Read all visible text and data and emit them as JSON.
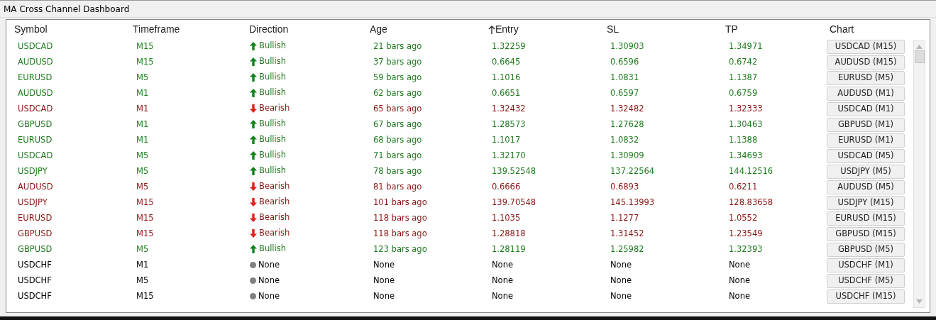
{
  "window": {
    "title": "MA Cross Channel Dashboard"
  },
  "table": {
    "columns": [
      {
        "label": "Symbol",
        "sorted": false
      },
      {
        "label": "Timeframe",
        "sorted": false
      },
      {
        "label": "Direction",
        "sorted": false
      },
      {
        "label": "Age",
        "sorted": false
      },
      {
        "label": "Entry",
        "sorted": true
      },
      {
        "label": "SL",
        "sorted": false
      },
      {
        "label": "TP",
        "sorted": false
      },
      {
        "label": "Chart",
        "sorted": false
      }
    ],
    "rows": [
      {
        "symbol": "USDCAD",
        "timeframe": "M15",
        "direction": "Bullish",
        "kind": "bullish",
        "age": "21 bars ago",
        "entry": "1.32259",
        "sl": "1.30903",
        "tp": "1.34971",
        "chart": "USDCAD (M15)"
      },
      {
        "symbol": "AUDUSD",
        "timeframe": "M15",
        "direction": "Bullish",
        "kind": "bullish",
        "age": "37 bars ago",
        "entry": "0.6645",
        "sl": "0.6596",
        "tp": "0.6742",
        "chart": "AUDUSD (M15)"
      },
      {
        "symbol": "EURUSD",
        "timeframe": "M5",
        "direction": "Bullish",
        "kind": "bullish",
        "age": "59 bars ago",
        "entry": "1.1016",
        "sl": "1.0831",
        "tp": "1.1387",
        "chart": "EURUSD (M5)"
      },
      {
        "symbol": "AUDUSD",
        "timeframe": "M1",
        "direction": "Bullish",
        "kind": "bullish",
        "age": "62 bars ago",
        "entry": "0.6651",
        "sl": "0.6597",
        "tp": "0.6759",
        "chart": "AUDUSD (M1)"
      },
      {
        "symbol": "USDCAD",
        "timeframe": "M1",
        "direction": "Bearish",
        "kind": "bearish",
        "age": "65 bars ago",
        "entry": "1.32432",
        "sl": "1.32482",
        "tp": "1.32333",
        "chart": "USDCAD (M1)"
      },
      {
        "symbol": "GBPUSD",
        "timeframe": "M1",
        "direction": "Bullish",
        "kind": "bullish",
        "age": "67 bars ago",
        "entry": "1.28573",
        "sl": "1.27628",
        "tp": "1.30463",
        "chart": "GBPUSD (M1)"
      },
      {
        "symbol": "EURUSD",
        "timeframe": "M1",
        "direction": "Bullish",
        "kind": "bullish",
        "age": "68 bars ago",
        "entry": "1.1017",
        "sl": "1.0832",
        "tp": "1.1388",
        "chart": "EURUSD (M1)"
      },
      {
        "symbol": "USDCAD",
        "timeframe": "M5",
        "direction": "Bullish",
        "kind": "bullish",
        "age": "71 bars ago",
        "entry": "1.32170",
        "sl": "1.30909",
        "tp": "1.34693",
        "chart": "USDCAD (M5)"
      },
      {
        "symbol": "USDJPY",
        "timeframe": "M5",
        "direction": "Bullish",
        "kind": "bullish",
        "age": "78 bars ago",
        "entry": "139.52548",
        "sl": "137.22564",
        "tp": "144.12516",
        "chart": "USDJPY (M5)"
      },
      {
        "symbol": "AUDUSD",
        "timeframe": "M5",
        "direction": "Bearish",
        "kind": "bearish",
        "age": "81 bars ago",
        "entry": "0.6666",
        "sl": "0.6893",
        "tp": "0.6211",
        "chart": "AUDUSD (M5)"
      },
      {
        "symbol": "USDJPY",
        "timeframe": "M15",
        "direction": "Bearish",
        "kind": "bearish",
        "age": "101 bars ago",
        "entry": "139.70548",
        "sl": "145.13993",
        "tp": "128.83658",
        "chart": "USDJPY (M15)"
      },
      {
        "symbol": "EURUSD",
        "timeframe": "M15",
        "direction": "Bearish",
        "kind": "bearish",
        "age": "118 bars ago",
        "entry": "1.1035",
        "sl": "1.1277",
        "tp": "1.0552",
        "chart": "EURUSD (M15)"
      },
      {
        "symbol": "GBPUSD",
        "timeframe": "M15",
        "direction": "Bearish",
        "kind": "bearish",
        "age": "118 bars ago",
        "entry": "1.28818",
        "sl": "1.31452",
        "tp": "1.23549",
        "chart": "GBPUSD (M15)"
      },
      {
        "symbol": "GBPUSD",
        "timeframe": "M5",
        "direction": "Bullish",
        "kind": "bullish",
        "age": "123 bars ago",
        "entry": "1.28119",
        "sl": "1.25982",
        "tp": "1.32393",
        "chart": "GBPUSD (M5)"
      },
      {
        "symbol": "USDCHF",
        "timeframe": "M1",
        "direction": "None",
        "kind": "none",
        "age": "None",
        "entry": "None",
        "sl": "None",
        "tp": "None",
        "chart": "USDCHF (M1)"
      },
      {
        "symbol": "USDCHF",
        "timeframe": "M5",
        "direction": "None",
        "kind": "none",
        "age": "None",
        "entry": "None",
        "sl": "None",
        "tp": "None",
        "chart": "USDCHF (M5)"
      },
      {
        "symbol": "USDCHF",
        "timeframe": "M15",
        "direction": "None",
        "kind": "none",
        "age": "None",
        "entry": "None",
        "sl": "None",
        "tp": "None",
        "chart": "USDCHF (M15)"
      }
    ]
  }
}
